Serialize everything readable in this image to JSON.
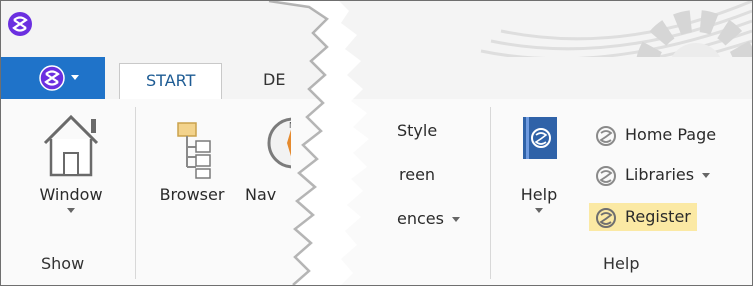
{
  "tabs": {
    "active": "START",
    "second": "DE"
  },
  "show_group": {
    "window_label": "Window",
    "group_label": "Show"
  },
  "middle": {
    "browser_label": "Browser",
    "navigator_label": "Nav"
  },
  "partial_right": {
    "item1": "Style",
    "item2": "reen",
    "item3": "ences"
  },
  "help_group": {
    "help_label": "Help",
    "group_label": "Help",
    "items": [
      {
        "label": "Home Page"
      },
      {
        "label": "Libraries"
      },
      {
        "label": "Register"
      }
    ]
  },
  "icons": [
    "app-logo-icon",
    "window-home-icon",
    "browser-icon",
    "navigator-compass-icon",
    "help-book-icon",
    "home-page-icon",
    "libraries-icon",
    "register-icon"
  ],
  "colors": {
    "app_menu": "#1f73c9",
    "active_tab_text": "#1e5c94",
    "register_highlight": "#fbe9a4",
    "logo_purple": "#6b2fe0"
  }
}
